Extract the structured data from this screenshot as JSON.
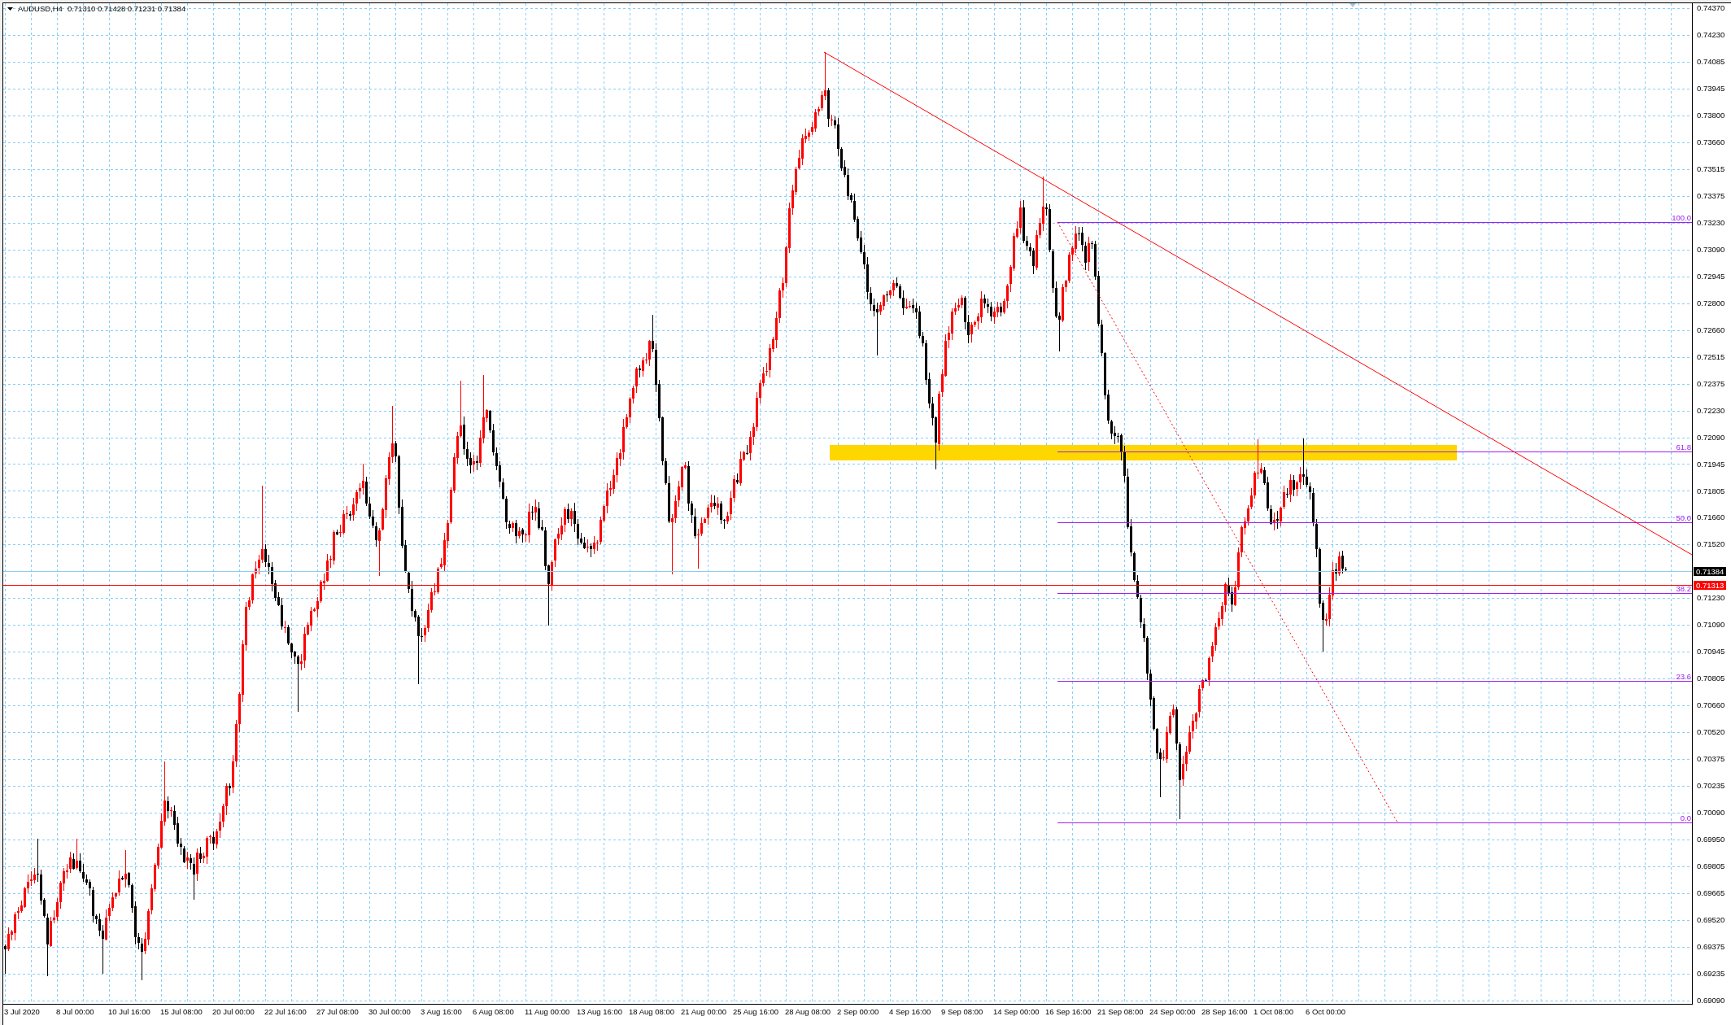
{
  "chart": {
    "symbol": "AUDUSD,H4",
    "ohlc": "0.71310 0.71428 0.71231 0.71384",
    "fibonacci_levels": [
      "100.0",
      "61.8",
      "50.0",
      "38.2",
      "23.6",
      "0.0"
    ]
  },
  "price_axis": [
    {
      "kind": "tick",
      "label": "0.74370"
    },
    {
      "kind": "tick",
      "label": "0.74230"
    },
    {
      "kind": "tick",
      "label": "0.74085"
    },
    {
      "kind": "tick",
      "label": "0.73945"
    },
    {
      "kind": "tick",
      "label": "0.73800"
    },
    {
      "kind": "tick",
      "label": "0.73660"
    },
    {
      "kind": "tick",
      "label": "0.73515"
    },
    {
      "kind": "tick",
      "label": "0.73375"
    },
    {
      "kind": "tick",
      "label": "0.73230"
    },
    {
      "kind": "tick",
      "label": "0.73090"
    },
    {
      "kind": "tick",
      "label": "0.72945"
    },
    {
      "kind": "tick",
      "label": "0.72800"
    },
    {
      "kind": "tick",
      "label": "0.72660"
    },
    {
      "kind": "tick",
      "label": "0.72515"
    },
    {
      "kind": "tick",
      "label": "0.72375"
    },
    {
      "kind": "tick",
      "label": "0.72230"
    },
    {
      "kind": "tick",
      "label": "0.72090"
    },
    {
      "kind": "tick",
      "label": "0.71945"
    },
    {
      "kind": "tick",
      "label": "0.71805"
    },
    {
      "kind": "tick",
      "label": "0.71660"
    },
    {
      "kind": "tick",
      "label": "0.71520"
    },
    {
      "kind": "bid_tag",
      "label": "0.71384"
    },
    {
      "kind": "line_tag",
      "label": "0.71313"
    },
    {
      "kind": "tick",
      "label": "0.71230"
    },
    {
      "kind": "tick",
      "label": "0.71090"
    },
    {
      "kind": "tick",
      "label": "0.70945"
    },
    {
      "kind": "tick",
      "label": "0.70805"
    },
    {
      "kind": "tick",
      "label": "0.70660"
    },
    {
      "kind": "tick",
      "label": "0.70520"
    },
    {
      "kind": "tick",
      "label": "0.70375"
    },
    {
      "kind": "tick",
      "label": "0.70235"
    },
    {
      "kind": "tick",
      "label": "0.70090"
    },
    {
      "kind": "tick",
      "label": "0.69950"
    },
    {
      "kind": "tick",
      "label": "0.69805"
    },
    {
      "kind": "tick",
      "label": "0.69665"
    },
    {
      "kind": "tick",
      "label": "0.69520"
    },
    {
      "kind": "tick",
      "label": "0.69375"
    },
    {
      "kind": "tick",
      "label": "0.69235"
    },
    {
      "kind": "tick",
      "label": "0.69090"
    }
  ],
  "time_axis": [
    "3 Jul 2020",
    "8 Jul 00:00",
    "10 Jul 16:00",
    "15 Jul 08:00",
    "20 Jul 00:00",
    "22 Jul 16:00",
    "27 Jul 08:00",
    "30 Jul 00:00",
    "3 Aug 16:00",
    "6 Aug 08:00",
    "11 Aug 00:00",
    "13 Aug 16:00",
    "18 Aug 08:00",
    "21 Aug 00:00",
    "25 Aug 16:00",
    "28 Aug 08:00",
    "2 Sep 00:00",
    "4 Sep 16:00",
    "9 Sep 08:00",
    "14 Sep 00:00",
    "16 Sep 16:00",
    "21 Sep 08:00",
    "24 Sep 00:00",
    "28 Sep 16:00",
    "1 Oct 08:00",
    "6 Oct 00:00"
  ]
}
